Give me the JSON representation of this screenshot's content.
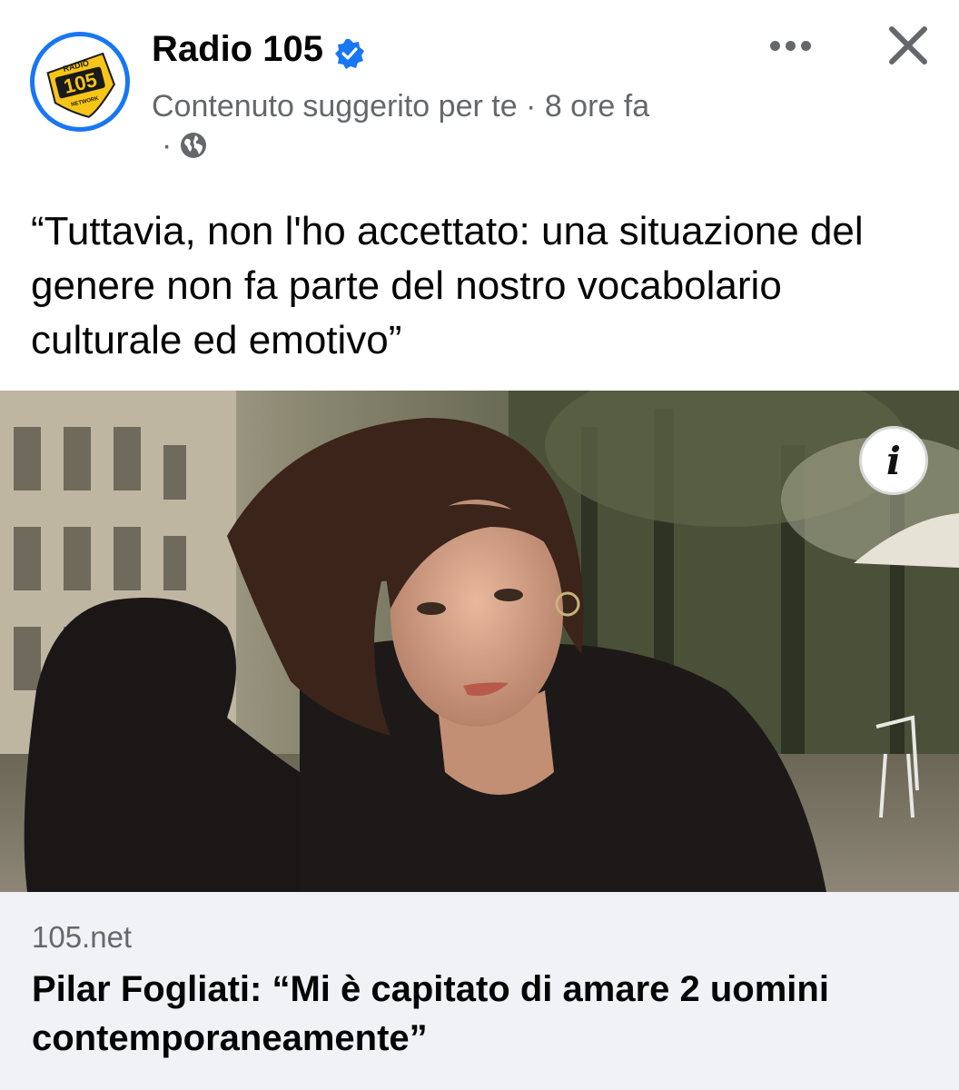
{
  "post": {
    "page_name": "Radio 105",
    "avatar_text": "105",
    "avatar_badge_top": "RADIO",
    "avatar_badge_bottom": "NETWORK",
    "meta": "Contenuto suggerito per te · 8 ore fa",
    "meta_dot": "·",
    "caption": "“Tuttavia, non l'ho accettato: una situazione del genere non fa parte del nostro vocabolario culturale ed emotivo”",
    "info_icon": "i"
  },
  "link_preview": {
    "domain": "105.net",
    "title": "Pilar Fogliati: “Mi è capitato di amare 2 uomini contemporaneamente”"
  },
  "icons": {
    "verified": "verified-badge-icon",
    "globe": "globe-icon",
    "more": "more-options-icon",
    "close": "close-icon",
    "info": "info-icon"
  },
  "colors": {
    "brand_blue": "#1877f2",
    "logo_yellow": "#f6c518",
    "secondary_text": "#65676b",
    "link_bg": "#f0f2f5"
  }
}
